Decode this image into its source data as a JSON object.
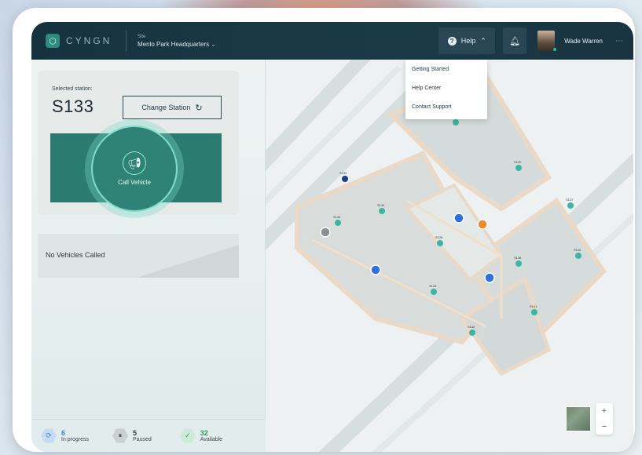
{
  "header": {
    "logo_text": "CYNGN",
    "site_label": "Site",
    "site_name": "Menlo Park Headquarters",
    "help_label": "Help",
    "user_name": "Wade Warren"
  },
  "help_menu": [
    "Getting Started",
    "Help Center",
    "Contact Support"
  ],
  "station": {
    "label": "Selected station:",
    "id": "S133",
    "change_label": "Change Station",
    "call_label": "Call Vehicle"
  },
  "vehicles": {
    "empty_text": "No Vehicles Called"
  },
  "status": [
    {
      "count": "6",
      "label": "In progress",
      "color": "#3e7fd0",
      "icon": "refresh-icon"
    },
    {
      "count": "5",
      "label": "Paused",
      "color": "#2b3a40",
      "icon": "pause-icon"
    },
    {
      "count": "32",
      "label": "Available",
      "color": "#2e9a5c",
      "icon": "check-icon"
    }
  ],
  "map": {
    "stations": [
      "S133",
      "S134",
      "S139",
      "S144",
      "S126",
      "S137",
      "S140",
      "S136",
      "S143",
      "S141",
      "S142"
    ]
  },
  "colors": {
    "accent": "#2c7b70",
    "topbar": "#17323f"
  }
}
